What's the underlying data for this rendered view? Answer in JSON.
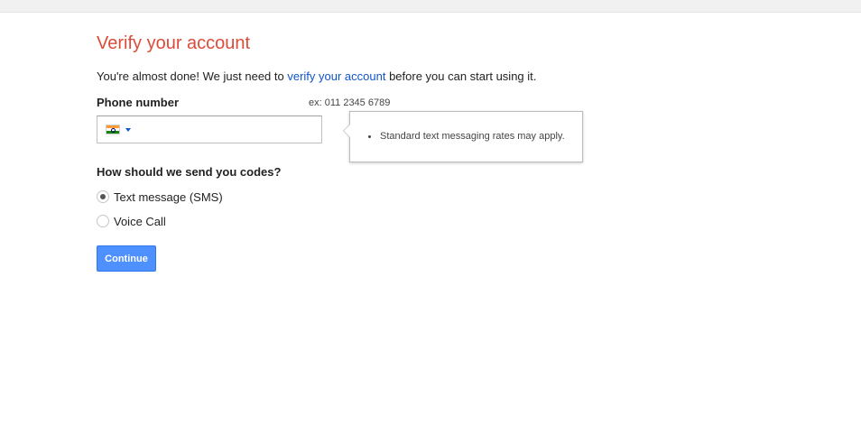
{
  "page": {
    "title": "Verify your account",
    "intro_before": "You're almost done! We just need to ",
    "intro_link": "verify your account",
    "intro_after": " before you can start using it."
  },
  "phone": {
    "label": "Phone number",
    "example": "ex: 011 2345 6789",
    "country_flag": "india-flag-icon",
    "value": ""
  },
  "tooltip": {
    "items": [
      "Standard text messaging rates may apply."
    ]
  },
  "delivery": {
    "label": "How should we send you codes?",
    "options": [
      {
        "label": "Text message (SMS)",
        "checked": true
      },
      {
        "label": "Voice Call",
        "checked": false
      }
    ]
  },
  "actions": {
    "continue_label": "Continue"
  },
  "colors": {
    "title": "#dd4b39",
    "link": "#1155cc",
    "primary_button": "#4d90fe"
  }
}
